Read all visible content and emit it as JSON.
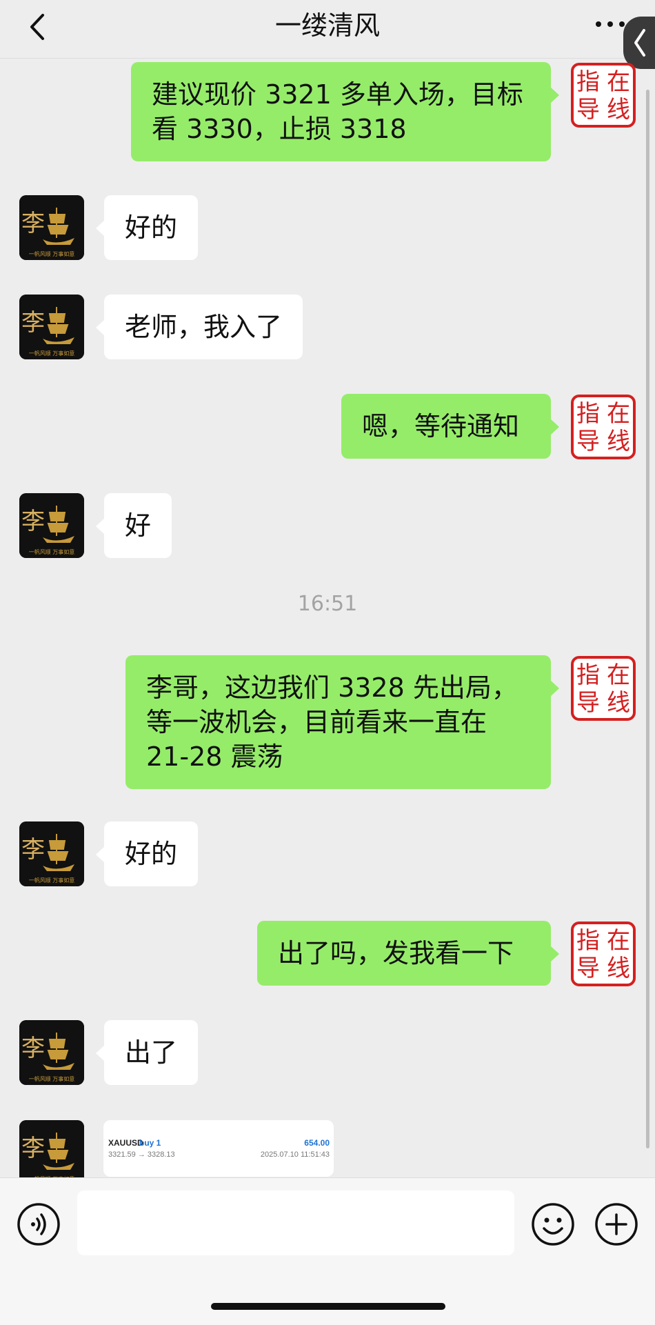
{
  "header": {
    "title": "一缕清风"
  },
  "colors": {
    "outgoing_bubble": "#95ec69",
    "incoming_bubble": "#ffffff",
    "background": "#ededed",
    "badge_red": "#d42020"
  },
  "avatar": {
    "glyph": "李",
    "caption": "一帆风顺 万事如意"
  },
  "badge": {
    "chars": [
      "指",
      "在",
      "导",
      "线"
    ]
  },
  "messages": [
    {
      "side": "out",
      "text": "建议现价 3321 多单入场，目标看 3330，止损 3318"
    },
    {
      "side": "in",
      "text": "好的"
    },
    {
      "side": "in",
      "text": "老师，我入了"
    },
    {
      "side": "out",
      "text": "嗯，等待通知"
    },
    {
      "side": "in",
      "text": "好"
    },
    {
      "side": "out",
      "text": "李哥，这边我们 3328 先出局，等一波机会，目前看来一直在 21-28 震荡"
    },
    {
      "side": "in",
      "text": "好的"
    },
    {
      "side": "out",
      "text": "出了吗，发我看一下"
    },
    {
      "side": "in",
      "text": "出了"
    }
  ],
  "timestamp": "16:51",
  "trade_card": {
    "symbol": "XAUUSD",
    "side": "buy 1",
    "profit": "654.00",
    "prices": "3321.59 → 3328.13",
    "datetime": "2025.07.10 11:51:43"
  },
  "input": {
    "placeholder": ""
  },
  "icons": {
    "back": "chevron-left-icon",
    "more": "more-dots-icon",
    "voice": "voice-icon",
    "emoji": "emoji-icon",
    "plus": "plus-icon"
  }
}
